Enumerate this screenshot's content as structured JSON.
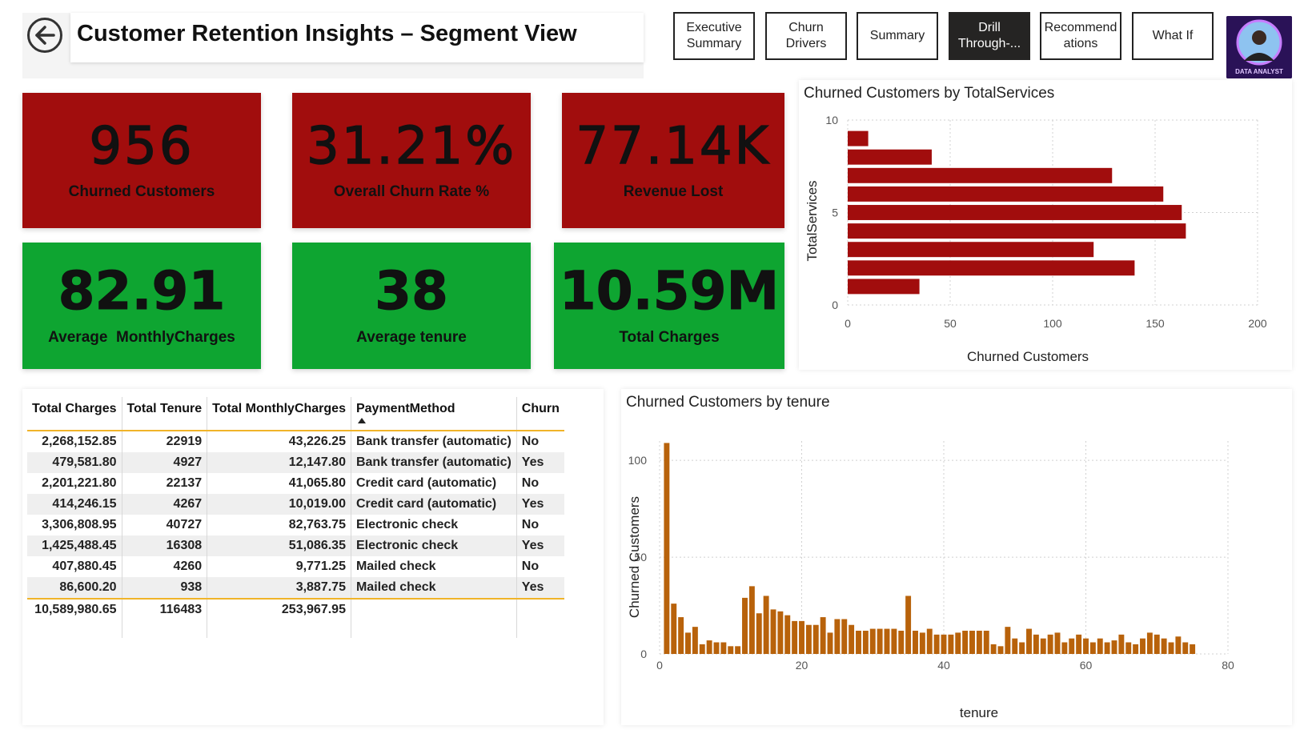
{
  "header": {
    "title": "Customer Retention Insights – Segment View",
    "back_icon": "back-arrow-icon"
  },
  "nav": [
    {
      "label": "Executive Summary",
      "active": false
    },
    {
      "label": "Churn Drivers",
      "active": false
    },
    {
      "label": "Summary",
      "active": false
    },
    {
      "label": "Drill Through-...",
      "active": true
    },
    {
      "label": "Recommendations",
      "active": false
    },
    {
      "label": "What If",
      "active": false
    }
  ],
  "avatar": {
    "text": "DATA ANALYST"
  },
  "kpis": {
    "churned_customers": {
      "value": "956",
      "label": "Churned Customers"
    },
    "churn_rate": {
      "value": "31.21%",
      "label": "Overall Churn Rate %"
    },
    "revenue_lost": {
      "value": "77.14K",
      "label": "Revenue Lost"
    },
    "avg_monthly": {
      "value": "82.91",
      "label": "Average  MonthlyCharges"
    },
    "avg_tenure": {
      "value": "38",
      "label": "Average tenure"
    },
    "total_charges": {
      "value": "10.59M",
      "label": "Total Charges"
    }
  },
  "colors": {
    "bad": "#a10d0d",
    "good": "#0ea531",
    "bar_services": "#a10d0d",
    "bar_tenure": "#b8620b",
    "accent_line": "#f0b429"
  },
  "table": {
    "headers": [
      "Total Charges",
      "Total Tenure",
      "Total MonthlyCharges",
      "PaymentMethod",
      "Churn"
    ],
    "rows": [
      [
        "2,268,152.85",
        "22919",
        "43,226.25",
        "Bank transfer (automatic)",
        "No"
      ],
      [
        "479,581.80",
        "4927",
        "12,147.80",
        "Bank transfer (automatic)",
        "Yes"
      ],
      [
        "2,201,221.80",
        "22137",
        "41,065.80",
        "Credit card (automatic)",
        "No"
      ],
      [
        "414,246.15",
        "4267",
        "10,019.00",
        "Credit card (automatic)",
        "Yes"
      ],
      [
        "3,306,808.95",
        "40727",
        "82,763.75",
        "Electronic check",
        "No"
      ],
      [
        "1,425,488.45",
        "16308",
        "51,086.35",
        "Electronic check",
        "Yes"
      ],
      [
        "407,880.45",
        "4260",
        "9,771.25",
        "Mailed check",
        "No"
      ],
      [
        "86,600.20",
        "938",
        "3,887.75",
        "Mailed check",
        "Yes"
      ]
    ],
    "totals": [
      "10,589,980.65",
      "116483",
      "253,967.95",
      "",
      ""
    ]
  },
  "chart_data": [
    {
      "type": "bar",
      "orientation": "horizontal",
      "title": "Churned Customers by TotalServices",
      "xlabel": "Churned Customers",
      "ylabel": "TotalServices",
      "xlim": [
        0,
        200
      ],
      "ylim": [
        0,
        10
      ],
      "xticks": [
        0,
        50,
        100,
        150,
        200
      ],
      "yticks": [
        0,
        5,
        10
      ],
      "categories": [
        1,
        2,
        3,
        4,
        5,
        6,
        7,
        8,
        9
      ],
      "values": [
        35,
        140,
        120,
        165,
        163,
        154,
        129,
        41,
        10
      ],
      "grid": true
    },
    {
      "type": "bar",
      "title": "Churned Customers by tenure",
      "xlabel": "tenure",
      "ylabel": "Churned Customers",
      "xlim": [
        0,
        80
      ],
      "ylim": [
        0,
        110
      ],
      "xticks": [
        0,
        20,
        40,
        60,
        80
      ],
      "yticks": [
        0,
        50,
        100
      ],
      "x": [
        1,
        2,
        3,
        4,
        5,
        6,
        7,
        8,
        9,
        10,
        11,
        12,
        13,
        14,
        15,
        16,
        17,
        18,
        19,
        20,
        21,
        22,
        23,
        24,
        25,
        26,
        27,
        28,
        29,
        30,
        31,
        32,
        33,
        34,
        35,
        36,
        37,
        38,
        39,
        40,
        41,
        42,
        43,
        44,
        45,
        46,
        47,
        48,
        49,
        50,
        51,
        52,
        53,
        54,
        55,
        56,
        57,
        58,
        59,
        60,
        61,
        62,
        63,
        64,
        65,
        66,
        67,
        68,
        69,
        70,
        71,
        72
      ],
      "values": [
        109,
        26,
        19,
        11,
        14,
        5,
        7,
        6,
        6,
        4,
        4,
        29,
        35,
        21,
        30,
        23,
        22,
        20,
        17,
        17,
        15,
        15,
        19,
        11,
        18,
        18,
        15,
        12,
        12,
        13,
        13,
        13,
        13,
        12,
        30,
        12,
        11,
        13,
        10,
        10,
        10,
        11,
        12,
        12,
        12,
        12,
        5,
        4,
        14,
        8,
        6,
        13,
        10,
        8,
        10,
        11,
        6,
        8,
        10,
        8,
        6,
        8,
        6,
        7,
        10,
        6,
        5,
        8,
        11,
        10,
        8,
        6,
        9,
        6,
        5
      ],
      "grid": true
    }
  ]
}
